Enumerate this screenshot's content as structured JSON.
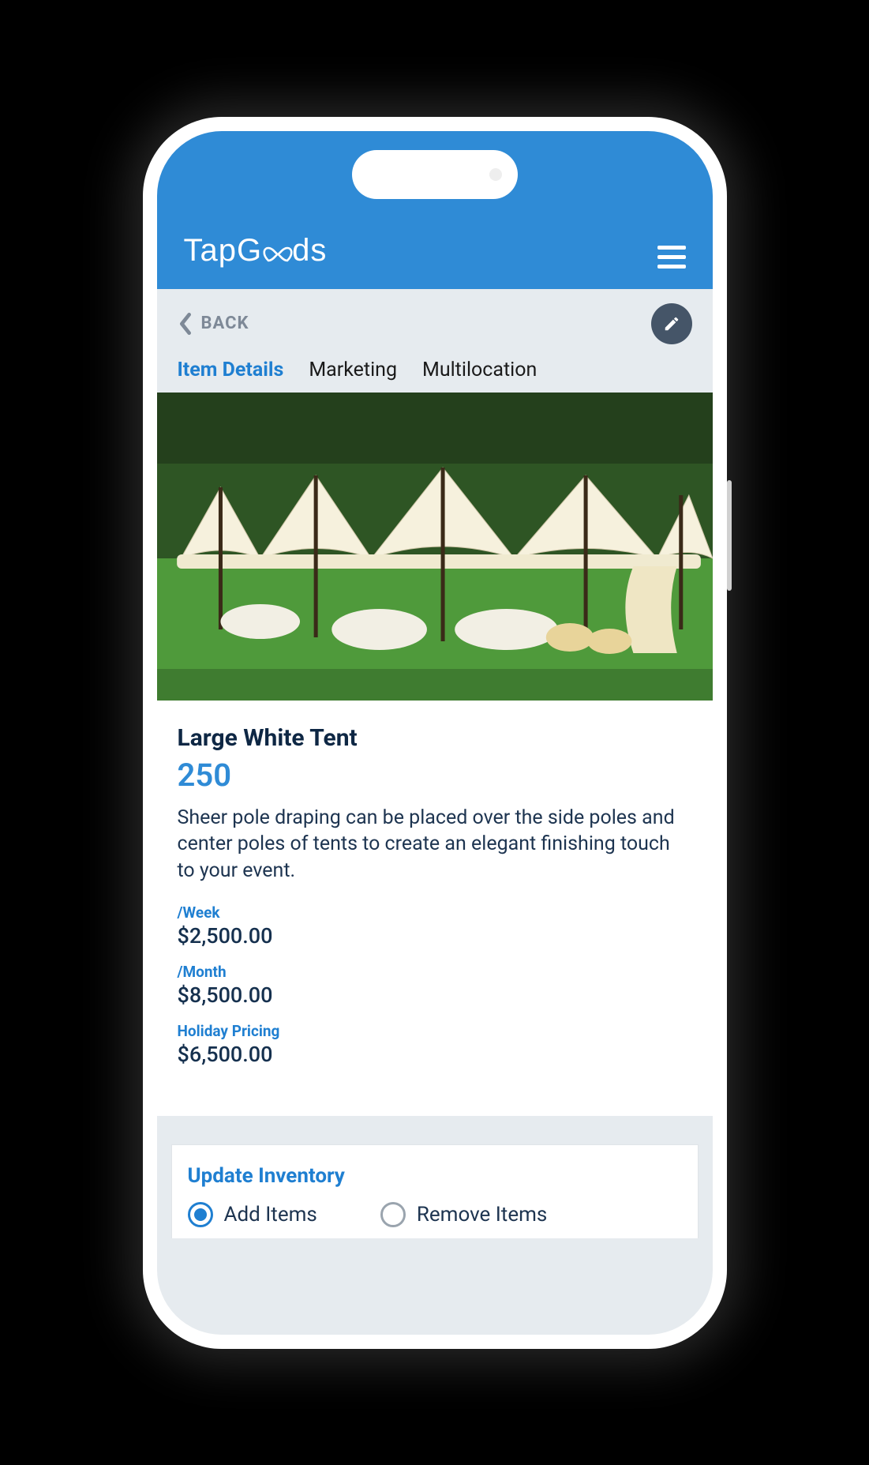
{
  "header": {
    "logo_text_1": "TapG",
    "logo_text_2": "ds"
  },
  "subheader": {
    "back_label": "BACK"
  },
  "tabs": [
    {
      "label": "Item Details",
      "active": true
    },
    {
      "label": "Marketing",
      "active": false
    },
    {
      "label": "Multilocation",
      "active": false
    }
  ],
  "item": {
    "title": "Large White Tent",
    "quantity": "250",
    "description": "Sheer pole draping can be placed over the side poles and center poles of tents to create an elegant finishing touch to your event."
  },
  "pricing": [
    {
      "label": "/Week",
      "value": "$2,500.00"
    },
    {
      "label": "/Month",
      "value": "$8,500.00"
    },
    {
      "label": "Holiday Pricing",
      "value": "$6,500.00"
    }
  ],
  "inventory": {
    "title": "Update Inventory",
    "options": [
      {
        "label": "Add Items",
        "selected": true
      },
      {
        "label": "Remove Items",
        "selected": false
      }
    ]
  }
}
